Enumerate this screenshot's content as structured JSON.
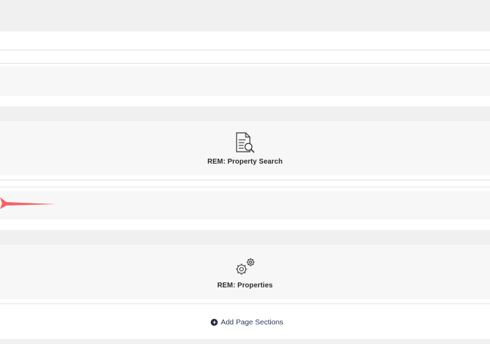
{
  "modules": [
    {
      "label": "REM: Property Search",
      "icon": "document-search-icon"
    },
    {
      "label": "REM: Properties",
      "icon": "gears-icon"
    }
  ],
  "footer": {
    "add_label": "Add Page Sections",
    "add_icon": "plus-circle-icon"
  },
  "annotation": {
    "icon": "red-arrow-pointer",
    "color": "#f26464"
  }
}
